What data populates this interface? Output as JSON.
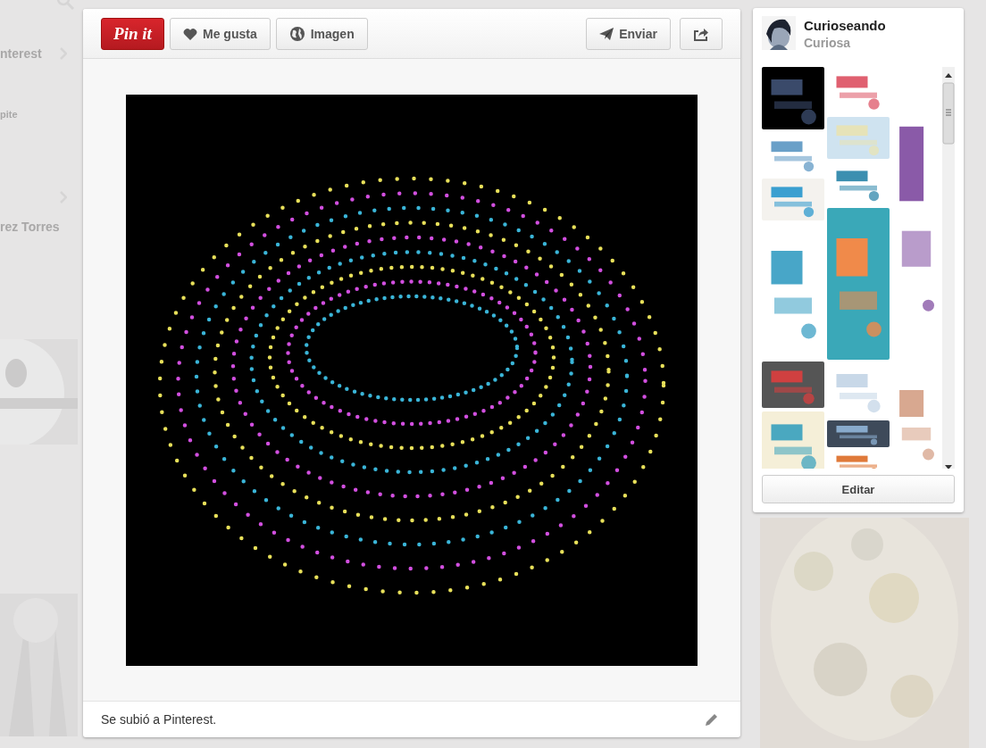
{
  "background": {
    "texts": [
      "nterest",
      "pite",
      "rez Torres"
    ]
  },
  "toolbar": {
    "pin_button": "Pin it",
    "left_buttons": [
      {
        "kind": "like",
        "label": "Me gusta"
      },
      {
        "label": "Imagen"
      }
    ],
    "right_buttons": [
      {
        "kind": "send",
        "label": "Enviar"
      },
      {
        "kind": "share"
      }
    ]
  },
  "pin": {
    "description": "Se subió a Pinterest."
  },
  "board": {
    "name": "Curioseando",
    "owner": "Curiosa",
    "button": "Editar"
  }
}
